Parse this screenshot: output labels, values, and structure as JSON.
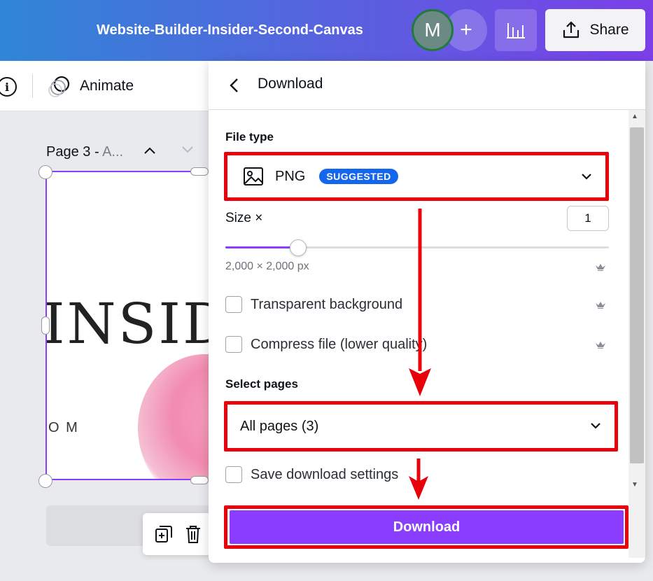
{
  "header": {
    "title": "Website-Builder-Insider-Second-Canvas",
    "avatar_initial": "M",
    "add_label": "+",
    "share_label": "Share"
  },
  "toolbar": {
    "info_label": "i",
    "animate_label": "Animate"
  },
  "canvas": {
    "page_label": "Page 3 - ",
    "page_label_muted": "A...",
    "page_text": "INSIDI",
    "page_text2": "O M"
  },
  "download_panel": {
    "title": "Download",
    "file_type_label": "File type",
    "file_type_value": "PNG",
    "suggested_badge": "SUGGESTED",
    "size_label": "Size ×",
    "size_value": "1",
    "size_slider_fraction": 0.19,
    "dimensions": "2,000 × 2,000 px",
    "options": [
      {
        "label": "Transparent background",
        "checked": false,
        "pro": true
      },
      {
        "label": "Compress file (lower quality)",
        "checked": false,
        "pro": true
      }
    ],
    "select_pages_label": "Select pages",
    "select_pages_value": "All pages (3)",
    "save_settings_label": "Save download settings",
    "download_button": "Download"
  },
  "colors": {
    "accent": "#8b3dff",
    "highlight": "#e8000b",
    "badge": "#1566ee"
  }
}
